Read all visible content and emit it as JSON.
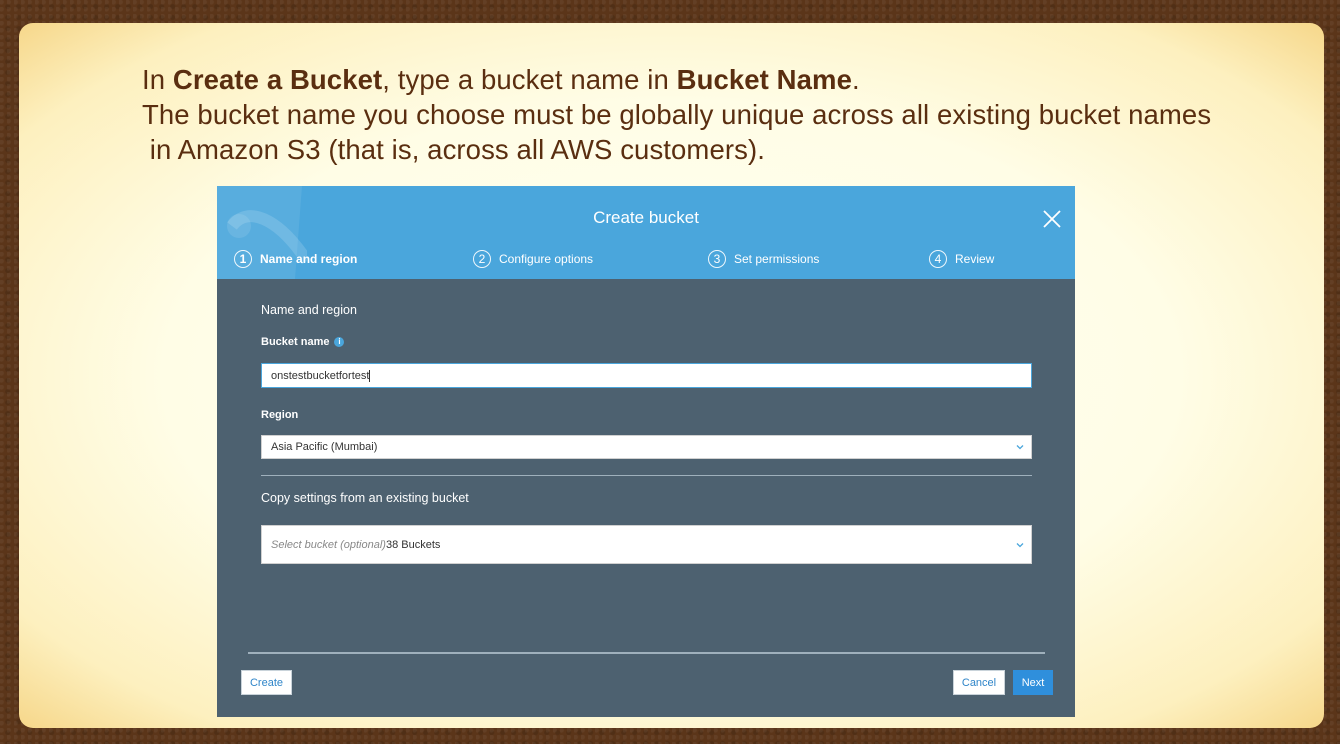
{
  "caption": {
    "line1_pre": "In ",
    "line1_bold1": "Create a Bucket",
    "line1_mid": ", type a bucket name in ",
    "line1_bold2": "Bucket Name",
    "line1_end": ".",
    "line2": "The bucket name you choose must be globally unique across all existing bucket names",
    "line3": " in Amazon S3 (that is, across all AWS customers)."
  },
  "dialog": {
    "title": "Create bucket",
    "steps": [
      {
        "num": "1",
        "label": "Name and region"
      },
      {
        "num": "2",
        "label": "Configure options"
      },
      {
        "num": "3",
        "label": "Set permissions"
      },
      {
        "num": "4",
        "label": "Review"
      }
    ],
    "active_step": 1,
    "section_title": "Name and region",
    "bucket_name_label": "Bucket name",
    "bucket_name_value": "onstestbucketfortest",
    "region_label": "Region",
    "region_value": "Asia Pacific (Mumbai)",
    "copy_title": "Copy settings from an existing bucket",
    "copy_placeholder": "Select bucket (optional)",
    "copy_count": "38 Buckets",
    "buttons": {
      "create": "Create",
      "cancel": "Cancel",
      "next": "Next"
    }
  },
  "icons": [
    "close-icon",
    "info-icon",
    "chevron-down-icon"
  ],
  "colors": {
    "header": "#4aa6dc",
    "body": "#4d6170",
    "primary_button": "#2f8fdc",
    "caption_text": "#5a2e10"
  }
}
